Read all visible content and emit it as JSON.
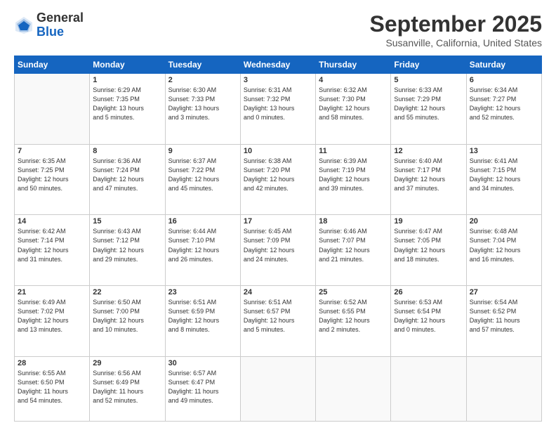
{
  "header": {
    "logo_general": "General",
    "logo_blue": "Blue",
    "month_title": "September 2025",
    "location": "Susanville, California, United States"
  },
  "weekdays": [
    "Sunday",
    "Monday",
    "Tuesday",
    "Wednesday",
    "Thursday",
    "Friday",
    "Saturday"
  ],
  "weeks": [
    [
      {
        "day": "",
        "info": ""
      },
      {
        "day": "1",
        "info": "Sunrise: 6:29 AM\nSunset: 7:35 PM\nDaylight: 13 hours\nand 5 minutes."
      },
      {
        "day": "2",
        "info": "Sunrise: 6:30 AM\nSunset: 7:33 PM\nDaylight: 13 hours\nand 3 minutes."
      },
      {
        "day": "3",
        "info": "Sunrise: 6:31 AM\nSunset: 7:32 PM\nDaylight: 13 hours\nand 0 minutes."
      },
      {
        "day": "4",
        "info": "Sunrise: 6:32 AM\nSunset: 7:30 PM\nDaylight: 12 hours\nand 58 minutes."
      },
      {
        "day": "5",
        "info": "Sunrise: 6:33 AM\nSunset: 7:29 PM\nDaylight: 12 hours\nand 55 minutes."
      },
      {
        "day": "6",
        "info": "Sunrise: 6:34 AM\nSunset: 7:27 PM\nDaylight: 12 hours\nand 52 minutes."
      }
    ],
    [
      {
        "day": "7",
        "info": "Sunrise: 6:35 AM\nSunset: 7:25 PM\nDaylight: 12 hours\nand 50 minutes."
      },
      {
        "day": "8",
        "info": "Sunrise: 6:36 AM\nSunset: 7:24 PM\nDaylight: 12 hours\nand 47 minutes."
      },
      {
        "day": "9",
        "info": "Sunrise: 6:37 AM\nSunset: 7:22 PM\nDaylight: 12 hours\nand 45 minutes."
      },
      {
        "day": "10",
        "info": "Sunrise: 6:38 AM\nSunset: 7:20 PM\nDaylight: 12 hours\nand 42 minutes."
      },
      {
        "day": "11",
        "info": "Sunrise: 6:39 AM\nSunset: 7:19 PM\nDaylight: 12 hours\nand 39 minutes."
      },
      {
        "day": "12",
        "info": "Sunrise: 6:40 AM\nSunset: 7:17 PM\nDaylight: 12 hours\nand 37 minutes."
      },
      {
        "day": "13",
        "info": "Sunrise: 6:41 AM\nSunset: 7:15 PM\nDaylight: 12 hours\nand 34 minutes."
      }
    ],
    [
      {
        "day": "14",
        "info": "Sunrise: 6:42 AM\nSunset: 7:14 PM\nDaylight: 12 hours\nand 31 minutes."
      },
      {
        "day": "15",
        "info": "Sunrise: 6:43 AM\nSunset: 7:12 PM\nDaylight: 12 hours\nand 29 minutes."
      },
      {
        "day": "16",
        "info": "Sunrise: 6:44 AM\nSunset: 7:10 PM\nDaylight: 12 hours\nand 26 minutes."
      },
      {
        "day": "17",
        "info": "Sunrise: 6:45 AM\nSunset: 7:09 PM\nDaylight: 12 hours\nand 24 minutes."
      },
      {
        "day": "18",
        "info": "Sunrise: 6:46 AM\nSunset: 7:07 PM\nDaylight: 12 hours\nand 21 minutes."
      },
      {
        "day": "19",
        "info": "Sunrise: 6:47 AM\nSunset: 7:05 PM\nDaylight: 12 hours\nand 18 minutes."
      },
      {
        "day": "20",
        "info": "Sunrise: 6:48 AM\nSunset: 7:04 PM\nDaylight: 12 hours\nand 16 minutes."
      }
    ],
    [
      {
        "day": "21",
        "info": "Sunrise: 6:49 AM\nSunset: 7:02 PM\nDaylight: 12 hours\nand 13 minutes."
      },
      {
        "day": "22",
        "info": "Sunrise: 6:50 AM\nSunset: 7:00 PM\nDaylight: 12 hours\nand 10 minutes."
      },
      {
        "day": "23",
        "info": "Sunrise: 6:51 AM\nSunset: 6:59 PM\nDaylight: 12 hours\nand 8 minutes."
      },
      {
        "day": "24",
        "info": "Sunrise: 6:51 AM\nSunset: 6:57 PM\nDaylight: 12 hours\nand 5 minutes."
      },
      {
        "day": "25",
        "info": "Sunrise: 6:52 AM\nSunset: 6:55 PM\nDaylight: 12 hours\nand 2 minutes."
      },
      {
        "day": "26",
        "info": "Sunrise: 6:53 AM\nSunset: 6:54 PM\nDaylight: 12 hours\nand 0 minutes."
      },
      {
        "day": "27",
        "info": "Sunrise: 6:54 AM\nSunset: 6:52 PM\nDaylight: 11 hours\nand 57 minutes."
      }
    ],
    [
      {
        "day": "28",
        "info": "Sunrise: 6:55 AM\nSunset: 6:50 PM\nDaylight: 11 hours\nand 54 minutes."
      },
      {
        "day": "29",
        "info": "Sunrise: 6:56 AM\nSunset: 6:49 PM\nDaylight: 11 hours\nand 52 minutes."
      },
      {
        "day": "30",
        "info": "Sunrise: 6:57 AM\nSunset: 6:47 PM\nDaylight: 11 hours\nand 49 minutes."
      },
      {
        "day": "",
        "info": ""
      },
      {
        "day": "",
        "info": ""
      },
      {
        "day": "",
        "info": ""
      },
      {
        "day": "",
        "info": ""
      }
    ]
  ]
}
